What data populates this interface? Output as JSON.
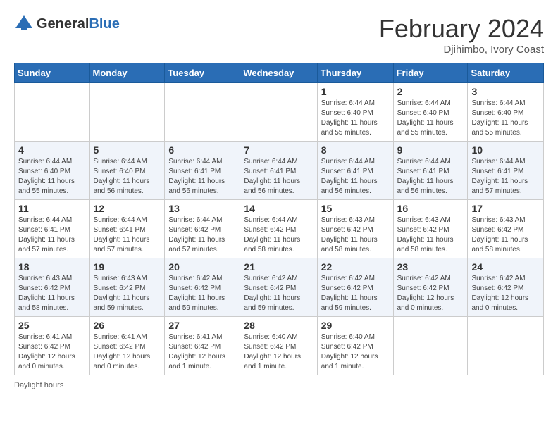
{
  "header": {
    "logo_general": "General",
    "logo_blue": "Blue",
    "month_year": "February 2024",
    "location": "Djihimbo, Ivory Coast"
  },
  "days_of_week": [
    "Sunday",
    "Monday",
    "Tuesday",
    "Wednesday",
    "Thursday",
    "Friday",
    "Saturday"
  ],
  "weeks": [
    [
      {
        "day": "",
        "info": ""
      },
      {
        "day": "",
        "info": ""
      },
      {
        "day": "",
        "info": ""
      },
      {
        "day": "",
        "info": ""
      },
      {
        "day": "1",
        "info": "Sunrise: 6:44 AM\nSunset: 6:40 PM\nDaylight: 11 hours and 55 minutes."
      },
      {
        "day": "2",
        "info": "Sunrise: 6:44 AM\nSunset: 6:40 PM\nDaylight: 11 hours and 55 minutes."
      },
      {
        "day": "3",
        "info": "Sunrise: 6:44 AM\nSunset: 6:40 PM\nDaylight: 11 hours and 55 minutes."
      }
    ],
    [
      {
        "day": "4",
        "info": "Sunrise: 6:44 AM\nSunset: 6:40 PM\nDaylight: 11 hours and 55 minutes."
      },
      {
        "day": "5",
        "info": "Sunrise: 6:44 AM\nSunset: 6:40 PM\nDaylight: 11 hours and 56 minutes."
      },
      {
        "day": "6",
        "info": "Sunrise: 6:44 AM\nSunset: 6:41 PM\nDaylight: 11 hours and 56 minutes."
      },
      {
        "day": "7",
        "info": "Sunrise: 6:44 AM\nSunset: 6:41 PM\nDaylight: 11 hours and 56 minutes."
      },
      {
        "day": "8",
        "info": "Sunrise: 6:44 AM\nSunset: 6:41 PM\nDaylight: 11 hours and 56 minutes."
      },
      {
        "day": "9",
        "info": "Sunrise: 6:44 AM\nSunset: 6:41 PM\nDaylight: 11 hours and 56 minutes."
      },
      {
        "day": "10",
        "info": "Sunrise: 6:44 AM\nSunset: 6:41 PM\nDaylight: 11 hours and 57 minutes."
      }
    ],
    [
      {
        "day": "11",
        "info": "Sunrise: 6:44 AM\nSunset: 6:41 PM\nDaylight: 11 hours and 57 minutes."
      },
      {
        "day": "12",
        "info": "Sunrise: 6:44 AM\nSunset: 6:41 PM\nDaylight: 11 hours and 57 minutes."
      },
      {
        "day": "13",
        "info": "Sunrise: 6:44 AM\nSunset: 6:42 PM\nDaylight: 11 hours and 57 minutes."
      },
      {
        "day": "14",
        "info": "Sunrise: 6:44 AM\nSunset: 6:42 PM\nDaylight: 11 hours and 58 minutes."
      },
      {
        "day": "15",
        "info": "Sunrise: 6:43 AM\nSunset: 6:42 PM\nDaylight: 11 hours and 58 minutes."
      },
      {
        "day": "16",
        "info": "Sunrise: 6:43 AM\nSunset: 6:42 PM\nDaylight: 11 hours and 58 minutes."
      },
      {
        "day": "17",
        "info": "Sunrise: 6:43 AM\nSunset: 6:42 PM\nDaylight: 11 hours and 58 minutes."
      }
    ],
    [
      {
        "day": "18",
        "info": "Sunrise: 6:43 AM\nSunset: 6:42 PM\nDaylight: 11 hours and 58 minutes."
      },
      {
        "day": "19",
        "info": "Sunrise: 6:43 AM\nSunset: 6:42 PM\nDaylight: 11 hours and 59 minutes."
      },
      {
        "day": "20",
        "info": "Sunrise: 6:42 AM\nSunset: 6:42 PM\nDaylight: 11 hours and 59 minutes."
      },
      {
        "day": "21",
        "info": "Sunrise: 6:42 AM\nSunset: 6:42 PM\nDaylight: 11 hours and 59 minutes."
      },
      {
        "day": "22",
        "info": "Sunrise: 6:42 AM\nSunset: 6:42 PM\nDaylight: 11 hours and 59 minutes."
      },
      {
        "day": "23",
        "info": "Sunrise: 6:42 AM\nSunset: 6:42 PM\nDaylight: 12 hours and 0 minutes."
      },
      {
        "day": "24",
        "info": "Sunrise: 6:42 AM\nSunset: 6:42 PM\nDaylight: 12 hours and 0 minutes."
      }
    ],
    [
      {
        "day": "25",
        "info": "Sunrise: 6:41 AM\nSunset: 6:42 PM\nDaylight: 12 hours and 0 minutes."
      },
      {
        "day": "26",
        "info": "Sunrise: 6:41 AM\nSunset: 6:42 PM\nDaylight: 12 hours and 0 minutes."
      },
      {
        "day": "27",
        "info": "Sunrise: 6:41 AM\nSunset: 6:42 PM\nDaylight: 12 hours and 1 minute."
      },
      {
        "day": "28",
        "info": "Sunrise: 6:40 AM\nSunset: 6:42 PM\nDaylight: 12 hours and 1 minute."
      },
      {
        "day": "29",
        "info": "Sunrise: 6:40 AM\nSunset: 6:42 PM\nDaylight: 12 hours and 1 minute."
      },
      {
        "day": "",
        "info": ""
      },
      {
        "day": "",
        "info": ""
      }
    ]
  ],
  "footer": {
    "daylight_label": "Daylight hours"
  }
}
